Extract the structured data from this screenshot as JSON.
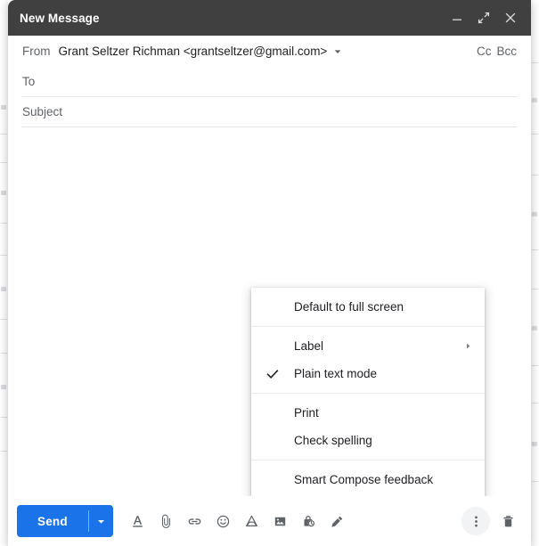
{
  "window": {
    "title": "New Message",
    "controls": [
      {
        "name": "minimize",
        "label": "Minimize",
        "icon": "minimize-icon"
      },
      {
        "name": "fullscreen",
        "label": "Full screen",
        "icon": "fullscreen-icon"
      },
      {
        "name": "close",
        "label": "Save & close",
        "icon": "close-icon"
      }
    ]
  },
  "fields": {
    "from_label": "From",
    "from_value": "Grant Seltzer Richman <grantseltzer@gmail.com>",
    "cc_label": "Cc",
    "bcc_label": "Bcc",
    "to_placeholder": "To",
    "to_value": "",
    "subject_placeholder": "Subject",
    "subject_value": "",
    "body_value": ""
  },
  "menu": {
    "groups": [
      {
        "items": [
          {
            "label": "Default to full screen",
            "checked": false,
            "submenu": false
          }
        ]
      },
      {
        "items": [
          {
            "label": "Label",
            "checked": false,
            "submenu": true
          },
          {
            "label": "Plain text mode",
            "checked": true,
            "submenu": false
          }
        ]
      },
      {
        "items": [
          {
            "label": "Print",
            "checked": false,
            "submenu": false
          },
          {
            "label": "Check spelling",
            "checked": false,
            "submenu": false
          }
        ]
      },
      {
        "items": [
          {
            "label": "Smart Compose feedback",
            "checked": false,
            "submenu": false
          }
        ]
      }
    ]
  },
  "toolbar": {
    "send_label": "Send",
    "send_dropdown_label": "More send options",
    "icons": [
      {
        "name": "format-text-icon",
        "label": "Formatting options"
      },
      {
        "name": "attach-file-icon",
        "label": "Attach files"
      },
      {
        "name": "insert-link-icon",
        "label": "Insert link"
      },
      {
        "name": "insert-emoji-icon",
        "label": "Insert emoji"
      },
      {
        "name": "insert-drive-icon",
        "label": "Insert files using Drive"
      },
      {
        "name": "insert-photo-icon",
        "label": "Insert photo"
      },
      {
        "name": "confidential-mode-icon",
        "label": "Toggle confidential mode"
      },
      {
        "name": "insert-signature-icon",
        "label": "Insert signature"
      }
    ],
    "more_options_label": "More options",
    "discard_label": "Discard draft"
  },
  "colors": {
    "header_bg": "#404040",
    "accent_blue": "#1a73e8",
    "icon_gray": "#5f6368",
    "text_dark": "#202124",
    "divider": "#e6e6e6"
  }
}
